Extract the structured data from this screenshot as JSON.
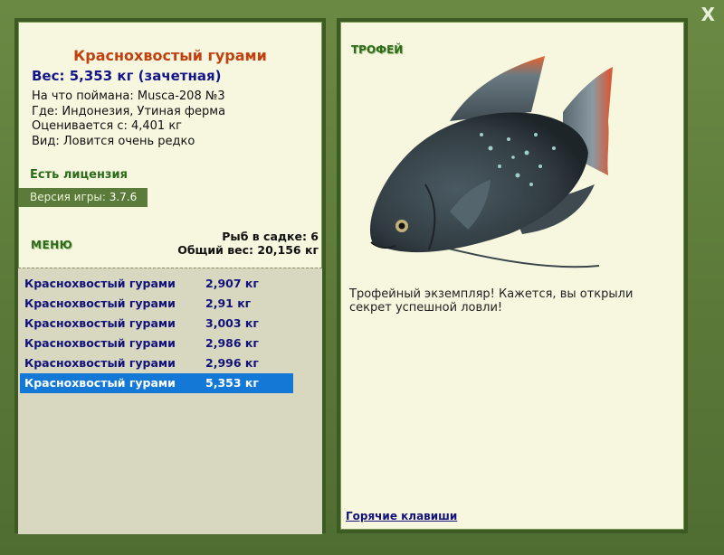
{
  "close_label": "X",
  "fish": {
    "name": "Краснохвостый гурами",
    "weight_line": "Вес: 5,353 кг (зачетная)",
    "caught_with": "На что поймана: Musca-208 №3",
    "location": "Где: Индонезия, Утиная ферма",
    "valued_from": "Оценивается с: 4,401 кг",
    "rarity": "Вид: Ловится очень редко"
  },
  "license": "Есть лицензия",
  "version": {
    "label": "Версия игры:",
    "value": "3.7.6"
  },
  "menu_label": "МЕНЮ",
  "keep_net": {
    "count_line": "Рыб в садке: 6",
    "total_line": "Общий вес: 20,156 кг"
  },
  "catch_list": [
    {
      "name": "Краснохвостый гурами",
      "weight": "2,907 кг",
      "selected": false
    },
    {
      "name": "Краснохвостый гурами",
      "weight": "2,91 кг",
      "selected": false
    },
    {
      "name": "Краснохвостый гурами",
      "weight": "3,003 кг",
      "selected": false
    },
    {
      "name": "Краснохвостый гурами",
      "weight": "2,986 кг",
      "selected": false
    },
    {
      "name": "Краснохвостый гурами",
      "weight": "2,996 кг",
      "selected": false
    },
    {
      "name": "Краснохвостый гурами",
      "weight": "5,353 кг",
      "selected": true
    }
  ],
  "trophy_label": "ТРОФЕЙ",
  "trophy_text": "Трофейный экземпляр! Кажется, вы открыли секрет успешной ловли!",
  "hotkeys_label": "Горячие клавиши",
  "colors": {
    "frame": "#5c7b3a",
    "panel": "#f7f7df",
    "selection": "#1479d6",
    "name_accent": "#c0400f"
  }
}
